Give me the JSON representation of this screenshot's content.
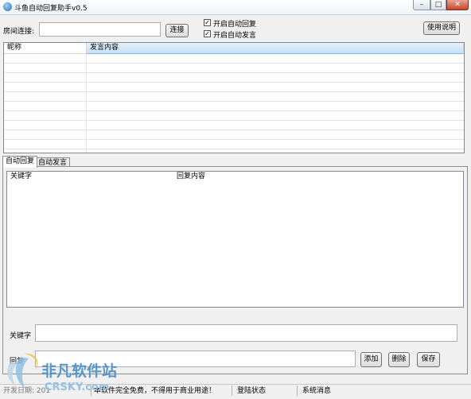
{
  "window": {
    "title": "斗鱼自动回复助手v0.5",
    "min_glyph": "–",
    "max_glyph": "□",
    "close_glyph": "✕"
  },
  "connect": {
    "room_label": "房间连接:",
    "room_value": "",
    "connect_button": "连接"
  },
  "options": {
    "auto_reply_label": "开启自动回复",
    "auto_reply_checked": true,
    "auto_speak_label": "开启自动发言",
    "auto_speak_checked": true,
    "check_glyph": "✓"
  },
  "help_button": "使用说明",
  "chat_table": {
    "columns": [
      "昵称",
      "发言内容"
    ],
    "rows": []
  },
  "tabs": [
    {
      "label": "自动回复",
      "active": true
    },
    {
      "label": "自动发言",
      "active": false
    }
  ],
  "reply_table": {
    "columns": [
      "关键字",
      "回复内容"
    ],
    "rows": []
  },
  "form": {
    "keyword_label": "关键字",
    "keyword_value": "",
    "reply_label": "回复",
    "reply_value": "",
    "add_button": "添加",
    "delete_button": "删除",
    "save_button": "保存"
  },
  "status": {
    "left_text": "开发日期: 201",
    "notice": "本软件完全免费，不得用于商业用途！",
    "login_state": "登陆状态",
    "system_msg": "系统消息"
  },
  "watermark": {
    "brand": "非凡软件站",
    "site": "CRSKY.com"
  }
}
